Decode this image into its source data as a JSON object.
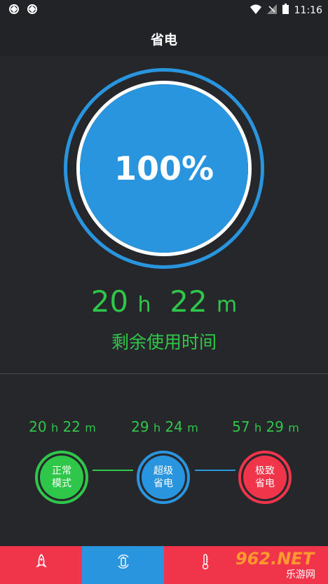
{
  "status": {
    "time": "11:16"
  },
  "appbar": {
    "title": "省电"
  },
  "battery": {
    "percent": "100%",
    "hours": "20",
    "h_unit": "h",
    "minutes": "22",
    "m_unit": "m",
    "remaining_label": "剩余使用时间"
  },
  "modes": [
    {
      "hours": "20",
      "minutes": "22",
      "label": "正常\n模式",
      "color": "#2fc74a"
    },
    {
      "hours": "29",
      "minutes": "24",
      "label": "超级\n省电",
      "color": "#2a95df"
    },
    {
      "hours": "57",
      "minutes": "29",
      "label": "极致\n省电",
      "color": "#f0344a"
    }
  ],
  "units": {
    "h": "h",
    "m": "m"
  },
  "tabs": [
    {
      "icon": "rocket-icon"
    },
    {
      "icon": "battery-saver-icon",
      "active": true
    },
    {
      "icon": "thermometer-icon"
    }
  ],
  "watermark": {
    "text": "962.NET",
    "sub": "乐游网"
  }
}
